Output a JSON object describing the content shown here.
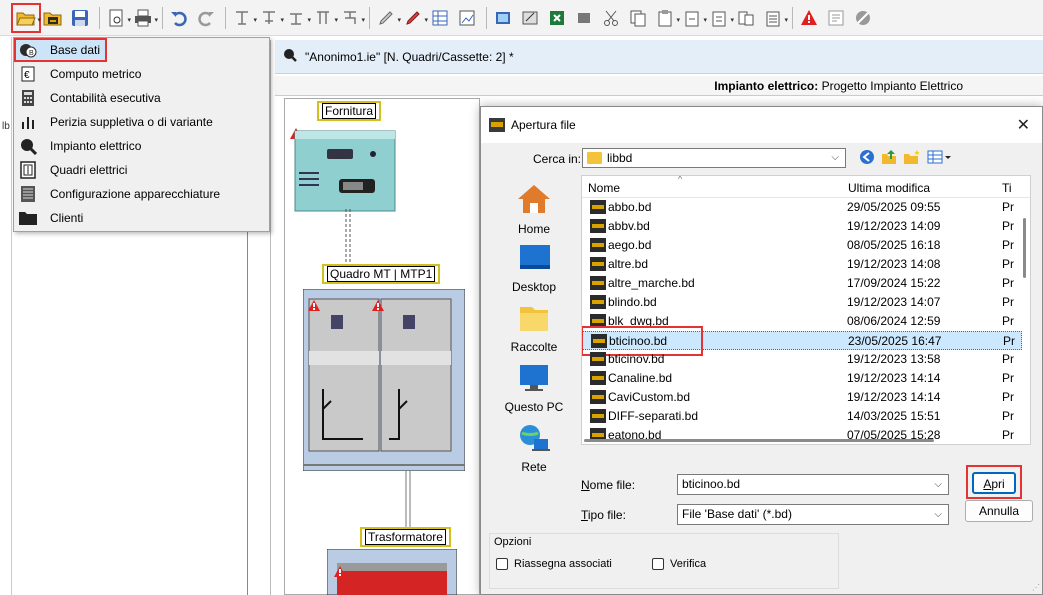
{
  "menu": {
    "items": [
      {
        "label": "Base dati",
        "icon": "database-icon",
        "selected": true
      },
      {
        "label": "Computo metrico",
        "icon": "computo-icon"
      },
      {
        "label": "Contabilità esecutiva",
        "icon": "calculator-icon"
      },
      {
        "label": "Perizia suppletiva o di variante",
        "icon": "bar-chart-icon"
      },
      {
        "label": "Impianto elettrico",
        "icon": "magnifier-icon"
      },
      {
        "label": "Quadri elettrici",
        "icon": "panel-icon"
      },
      {
        "label": "Configurazione apparecchiature",
        "icon": "config-icon"
      },
      {
        "label": "Clienti",
        "icon": "folder-icon"
      }
    ]
  },
  "left_panel": {
    "text": "lb"
  },
  "document": {
    "title": "\"Anonimo1.ie\" [N. Quadri/Cassette: 2] *",
    "project_label": "Impianto elettrico:",
    "project_name": "Progetto Impianto Elettrico"
  },
  "diagram": {
    "fornitura": "Fornitura",
    "quadro": "Quadro MT | MTP1",
    "trasformatore": "Trasformatore"
  },
  "dialog": {
    "title": "Apertura file",
    "close": "✕",
    "look_in_label": "Cerca in:",
    "look_in_value": "libbd",
    "places": [
      "Home",
      "Desktop",
      "Raccolte",
      "Questo PC",
      "Rete"
    ],
    "columns": {
      "name": "Nome",
      "date": "Ultima modifica",
      "type": "Ti"
    },
    "files": [
      {
        "name": "abbo.bd",
        "date": "29/05/2025 09:55",
        "type": "Pr"
      },
      {
        "name": "abbv.bd",
        "date": "19/12/2023 14:09",
        "type": "Pr"
      },
      {
        "name": "aego.bd",
        "date": "08/05/2025 16:18",
        "type": "Pr"
      },
      {
        "name": "altre.bd",
        "date": "19/12/2023 14:08",
        "type": "Pr"
      },
      {
        "name": "altre_marche.bd",
        "date": "17/09/2024 15:22",
        "type": "Pr"
      },
      {
        "name": "blindo.bd",
        "date": "19/12/2023 14:07",
        "type": "Pr"
      },
      {
        "name": "blk_dwg.bd",
        "date": "08/06/2024 12:59",
        "type": "Pr"
      },
      {
        "name": "bticinoo.bd",
        "date": "23/05/2025 16:47",
        "type": "Pr",
        "selected": true
      },
      {
        "name": "bticinov.bd",
        "date": "19/12/2023 13:58",
        "type": "Pr"
      },
      {
        "name": "Canaline.bd",
        "date": "19/12/2023 14:14",
        "type": "Pr"
      },
      {
        "name": "CaviCustom.bd",
        "date": "19/12/2023 14:14",
        "type": "Pr"
      },
      {
        "name": "DIFF-separati.bd",
        "date": "14/03/2025 15:51",
        "type": "Pr"
      },
      {
        "name": "eatono.bd",
        "date": "07/05/2025 15:28",
        "type": "Pr"
      }
    ],
    "filename_label_u": "N",
    "filename_label_rest": "ome file:",
    "filename_value": "bticinoo.bd",
    "filetype_label_u": "T",
    "filetype_label_rest": "ipo file:",
    "filetype_value": "File 'Base dati' (*.bd)",
    "open_u": "A",
    "open_rest": "pri",
    "cancel": "Annulla",
    "options_label": "Opzioni",
    "opt_reassign": "Riassegna associati",
    "opt_verify": "Verifica"
  }
}
